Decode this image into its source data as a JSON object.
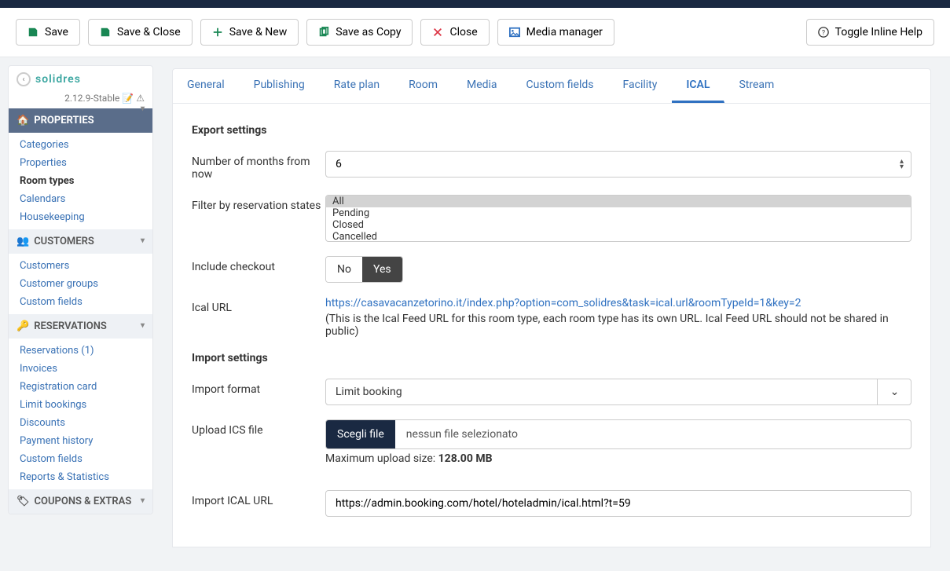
{
  "toolbar": {
    "save": "Save",
    "saveClose": "Save & Close",
    "saveNew": "Save & New",
    "saveCopy": "Save as Copy",
    "close": "Close",
    "mediaManager": "Media manager",
    "toggleHelp": "Toggle Inline Help"
  },
  "brand": {
    "name": "solidres",
    "version": "2.12.9-Stable"
  },
  "sidebar": {
    "properties": {
      "head": "PROPERTIES",
      "items": [
        "Categories",
        "Properties",
        "Room types",
        "Calendars",
        "Housekeeping"
      ],
      "activeIndex": 2
    },
    "customers": {
      "head": "CUSTOMERS",
      "items": [
        "Customers",
        "Customer groups",
        "Custom fields"
      ]
    },
    "reservations": {
      "head": "RESERVATIONS",
      "items": [
        "Reservations (1)",
        "Invoices",
        "Registration card",
        "Limit bookings",
        "Discounts",
        "Payment history",
        "Custom fields",
        "Reports & Statistics"
      ]
    },
    "coupons": {
      "head": "COUPONS & EXTRAS"
    }
  },
  "tabs": [
    "General",
    "Publishing",
    "Rate plan",
    "Room",
    "Media",
    "Custom fields",
    "Facility",
    "ICAL",
    "Stream"
  ],
  "tabsActive": 7,
  "export": {
    "title": "Export settings",
    "monthsLabel": "Number of months from now",
    "monthsValue": "6",
    "filterLabel": "Filter by reservation states",
    "states": [
      "All",
      "Pending",
      "Closed",
      "Cancelled"
    ],
    "checkoutLabel": "Include checkout",
    "no": "No",
    "yes": "Yes",
    "urlLabel": "Ical URL",
    "urlValue": "https://casavacanzetorino.it/index.php?option=com_solidres&task=ical.url&roomTypeId=1&key=2",
    "urlHint": "(This is the Ical Feed URL for this room type, each room type has its own URL. Ical Feed URL should not be shared in public)"
  },
  "import": {
    "title": "Import settings",
    "formatLabel": "Import format",
    "formatValue": "Limit booking",
    "uploadLabel": "Upload ICS file",
    "fileBtn": "Scegli file",
    "fileNone": "nessun file selezionato",
    "maxPrefix": "Maximum upload size: ",
    "maxValue": "128.00 MB",
    "importUrlLabel": "Import ICAL URL",
    "importUrlValue": "https://admin.booking.com/hotel/hoteladmin/ical.html?t=59"
  }
}
